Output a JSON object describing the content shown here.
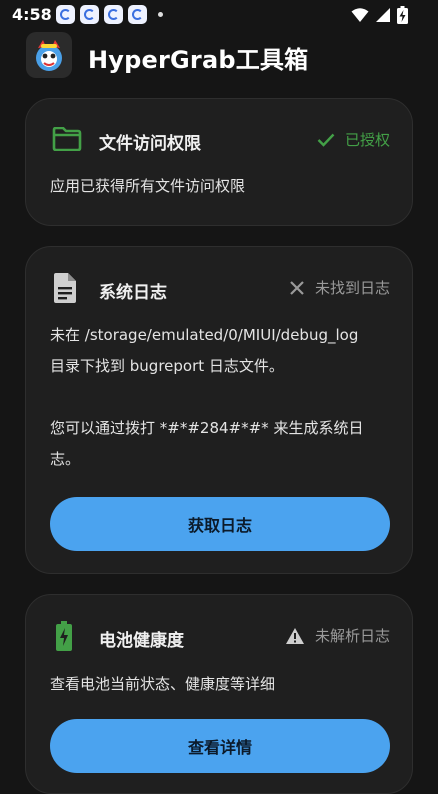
{
  "status_bar": {
    "time": "4:58"
  },
  "header": {
    "title": "HyperGrab工具箱"
  },
  "permission_card": {
    "title": "文件访问权限",
    "status": "已授权",
    "description": "应用已获得所有文件访问权限"
  },
  "log_card": {
    "title": "系统日志",
    "status": "未找到日志",
    "line1": "未在 /storage/emulated/0/MIUI/debug_log",
    "line2": "目录下找到 bugreport 日志文件。",
    "line3": "您可以通过拨打 *#*#284#*#* 来生成系统日",
    "line4": "志。",
    "button": "获取日志"
  },
  "battery_card": {
    "title": "电池健康度",
    "status": "未解析日志",
    "description": "查看电池当前状态、健康度等详细",
    "button": "查看详情"
  },
  "colors": {
    "background": "#151515",
    "card": "#1f1f1f",
    "accent_button": "#4ba3ef",
    "success_green": "#43a047",
    "muted": "#9a9a9a"
  }
}
